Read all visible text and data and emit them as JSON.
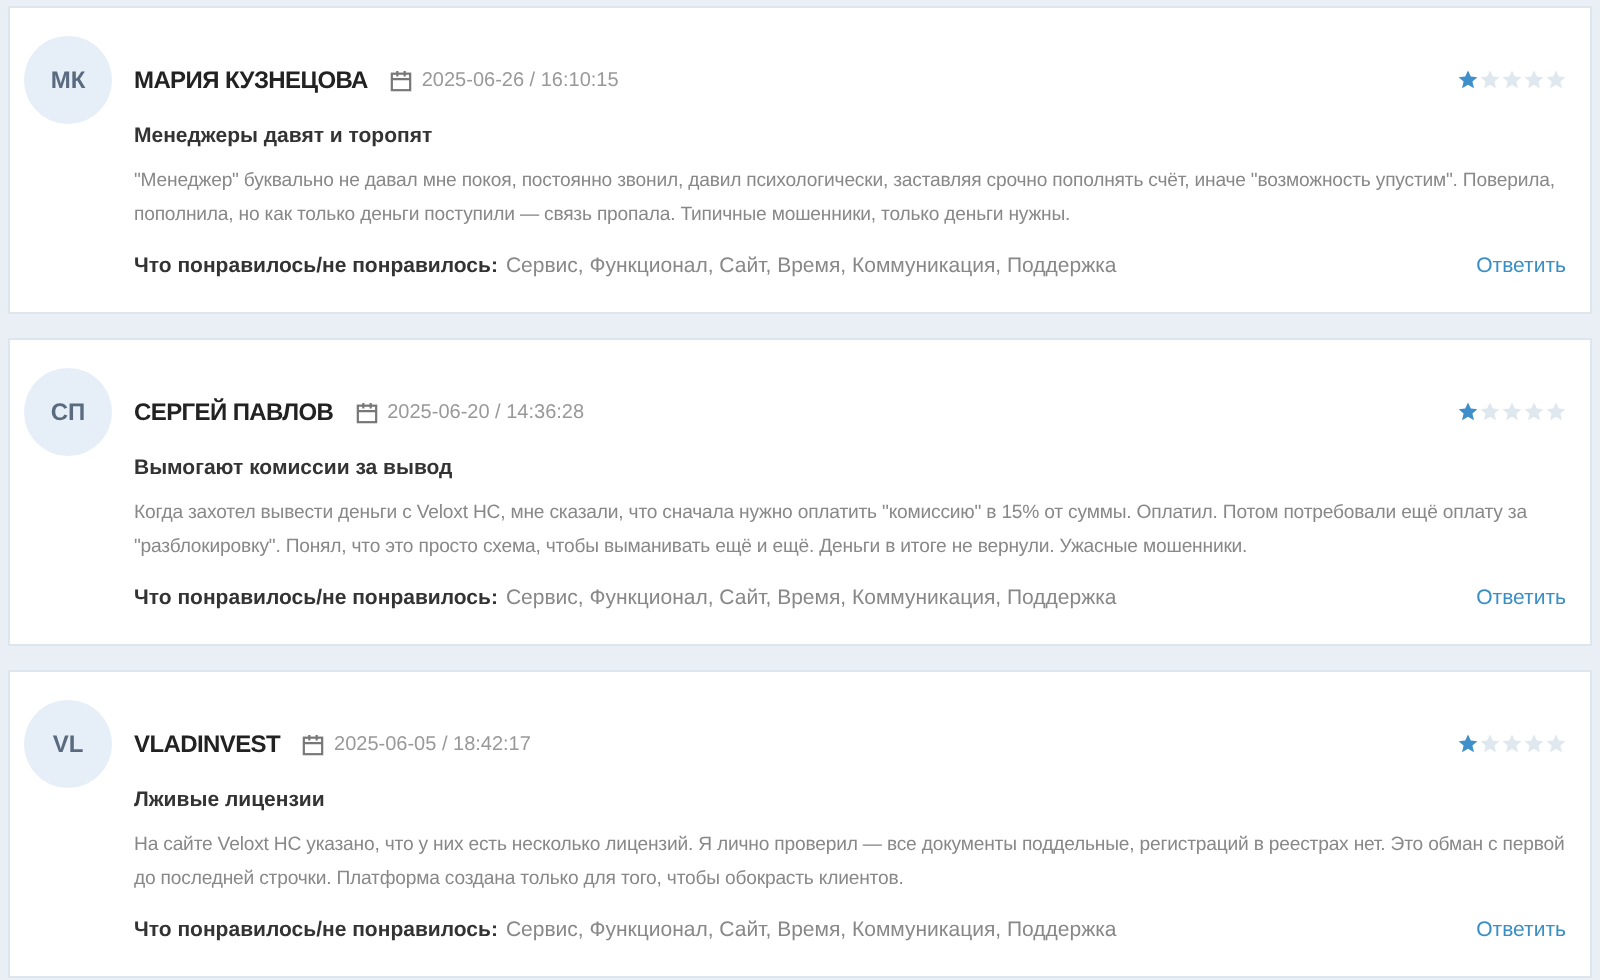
{
  "reviews": [
    {
      "initials": "МК",
      "author": "МАРИЯ КУЗНЕЦОВА",
      "date": "2025-06-26 / 16:10:15",
      "stars": 1,
      "title": "Менеджеры давят и торопят",
      "text": "\"Менеджер\" буквально не давал мне покоя, постоянно звонил, давил психологически, заставляя срочно пополнять счёт, иначе \"возможность упустим\". Поверила, пополнила, но как только деньги поступили — связь пропала. Типичные мошенники, только деньги нужны.",
      "likes_label": "Что понравилось/не понравилось:",
      "likes": "Сервис, Функционал, Сайт, Время, Коммуникация, Поддержка",
      "reply": "Ответить"
    },
    {
      "initials": "СП",
      "author": "СЕРГЕЙ ПАВЛОВ",
      "date": "2025-06-20 / 14:36:28",
      "stars": 1,
      "title": "Вымогают комиссии за вывод",
      "text": "Когда захотел вывести деньги с Veloxt HC, мне сказали, что сначала нужно оплатить \"комиссию\" в 15% от суммы. Оплатил. Потом потребовали ещё оплату за \"разблокировку\". Понял, что это просто схема, чтобы выманивать ещё и ещё. Деньги в итоге не вернули. Ужасные мошенники.",
      "likes_label": "Что понравилось/не понравилось:",
      "likes": "Сервис, Функционал, Сайт, Время, Коммуникация, Поддержка",
      "reply": "Ответить"
    },
    {
      "initials": "VL",
      "author": "VLADINVEST",
      "date": "2025-06-05 / 18:42:17",
      "stars": 1,
      "title": "Лживые лицензии",
      "text": "На сайте Veloxt HC указано, что у них есть несколько лицензий. Я лично проверил — все документы поддельные, регистраций в реестрах нет. Это обман с первой до последней строчки. Платформа создана только для того, чтобы обокрасть клиентов.",
      "likes_label": "Что понравилось/не понравилось:",
      "likes": "Сервис, Функционал, Сайт, Время, Коммуникация, Поддержка",
      "reply": "Ответить"
    }
  ]
}
